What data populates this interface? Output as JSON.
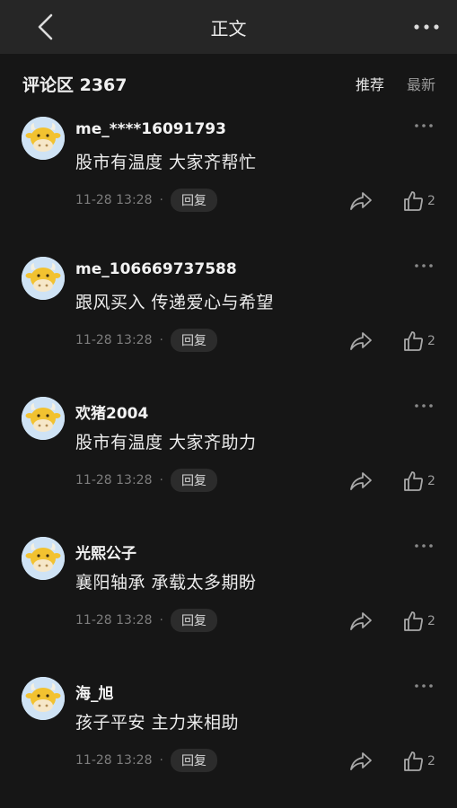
{
  "header": {
    "title": "正文",
    "back_icon": "chevron-left-icon",
    "more_icon": "more-horizontal-icon"
  },
  "comments_section": {
    "label": "评论区 2367",
    "sort_recommend": "推荐",
    "sort_newest": "最新"
  },
  "comments": [
    {
      "user": "me_****16091793",
      "text": "股市有温度 大家齐帮忙",
      "time": "11-28 13:28",
      "reply": "回复",
      "likes": "2"
    },
    {
      "user": "me_106669737588",
      "text": "跟风买入 传递爱心与希望",
      "time": "11-28 13:28",
      "reply": "回复",
      "likes": "2"
    },
    {
      "user": "欢猪2004",
      "text": "股市有温度 大家齐助力",
      "time": "11-28 13:28",
      "reply": "回复",
      "likes": "2"
    },
    {
      "user": "光熙公子",
      "text": "襄阳轴承 承载太多期盼",
      "time": "11-28 13:28",
      "reply": "回复",
      "likes": "2"
    },
    {
      "user": "海_旭",
      "text": "孩子平安 主力来相助",
      "time": "11-28 13:28",
      "reply": "回复",
      "likes": "2"
    }
  ],
  "colors": {
    "background": "#161616",
    "topbar": "#262626",
    "avatar_bg": "#cfe3f5",
    "avatar_cow": "#f2c230"
  }
}
